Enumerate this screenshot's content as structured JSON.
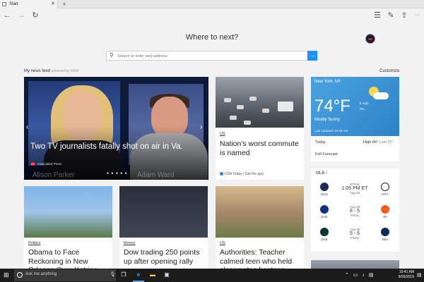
{
  "browser": {
    "tab_title": "Start",
    "tab_close": "✕",
    "new_tab": "+"
  },
  "nav": {
    "back": "←",
    "forward": "→",
    "refresh": "↻",
    "hub": "☰",
    "note": "✎",
    "share": "⇪",
    "more": "···"
  },
  "start": {
    "heading": "Where to next?",
    "search_placeholder": "Search or enter web address",
    "search_go": "→",
    "feed_label": "My news feed",
    "powered_by": "powered by MSN",
    "customize": "Customize"
  },
  "hero": {
    "headline": "Two TV journalists fatally shot on air in Va.",
    "source": "Associated Press",
    "name_left": "Alison Parker",
    "name_right": "Adam Ward",
    "dots": "● ● ● ● ●",
    "prev": "‹",
    "next": "›"
  },
  "card2": {
    "category": "US",
    "title": "Nation's worst commute is named",
    "source": "USA Today | Get the app"
  },
  "weather": {
    "location": "New York, NY",
    "temp": "74°F",
    "wind": "5 mph",
    "precip": "0%",
    "condition": "Mostly Sunny",
    "updated": "Last Updated 10:38 AM",
    "today_label": "Today",
    "hi": "High 84°",
    "lo": "Low 70°",
    "forecast": "Full Forecast",
    "colors": {
      "top": "#3b94d6",
      "sun": "#ffd54a"
    }
  },
  "mlb": {
    "header": "MLB ›",
    "games": [
      {
        "away": "HOU",
        "home": "NYY",
        "line1": "BTGW",
        "line2": "1:05 PM ET",
        "line3": "Aug 26"
      },
      {
        "away": "CHC",
        "home": "SF",
        "line1": "Aug 25",
        "line2": "8 - 5",
        "line3": "FINAL"
      },
      {
        "away": "OAK",
        "home": "SEA",
        "line1": "Aug 25",
        "line2": "5 - 6",
        "line3": "FINAL"
      }
    ]
  },
  "cards": [
    {
      "category": "Politics",
      "title": "Obama to Face Reckoning in New Orleans Over Katrina"
    },
    {
      "category": "Money",
      "title": "Dow trading 250 points up after opening rally"
    },
    {
      "category": "US",
      "title": "Authorities: Teacher calmed teen who held classmates hostage"
    }
  ],
  "taskbar": {
    "start_icon": "⊞",
    "cortana_text": "Ask me anything",
    "mic": "🎙",
    "task_view": "❐",
    "edge": "e",
    "explorer": "▬",
    "store": "▣",
    "tray": "⌃ ▭ ♪ ▤",
    "time": "10:41 AM",
    "date": "8/26/2015",
    "notifications": "▤"
  }
}
